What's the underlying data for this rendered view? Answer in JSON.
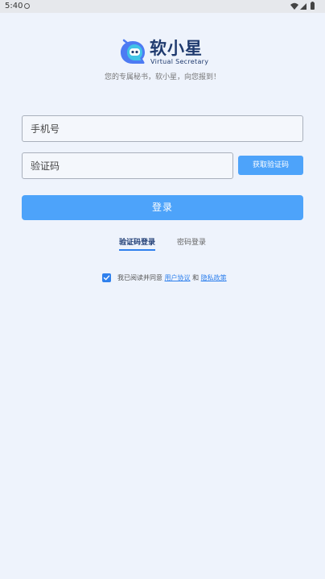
{
  "status_bar": {
    "time": "5:40",
    "icons": [
      "circle-icon",
      "wifi-icon",
      "signal-icon",
      "battery-icon"
    ]
  },
  "brand": {
    "title": "软小星",
    "subtitle": "Virtual Secretary",
    "tagline": "您的专属秘书，软小星，向您报到！",
    "logo_icon": "chat-bubble-face-icon",
    "colors": {
      "title": "#1F3A6E",
      "logo_primary": "#4D7BF3",
      "logo_secondary": "#41C3E6"
    }
  },
  "form": {
    "phone_placeholder": "手机号",
    "code_placeholder": "验证码",
    "get_code_label": "获取验证码",
    "login_label": "登录"
  },
  "tabs": [
    {
      "label": "验证码登录",
      "active": true
    },
    {
      "label": "密码登录",
      "active": false
    }
  ],
  "agreement": {
    "checked": true,
    "prefix": "我已阅读并同意",
    "user_agreement": "用户协议",
    "connector": "和",
    "privacy_policy": "隐私政策"
  },
  "colors": {
    "background": "#EEF3FC",
    "accent": "#4DA3FA",
    "link": "#2F80ED"
  }
}
